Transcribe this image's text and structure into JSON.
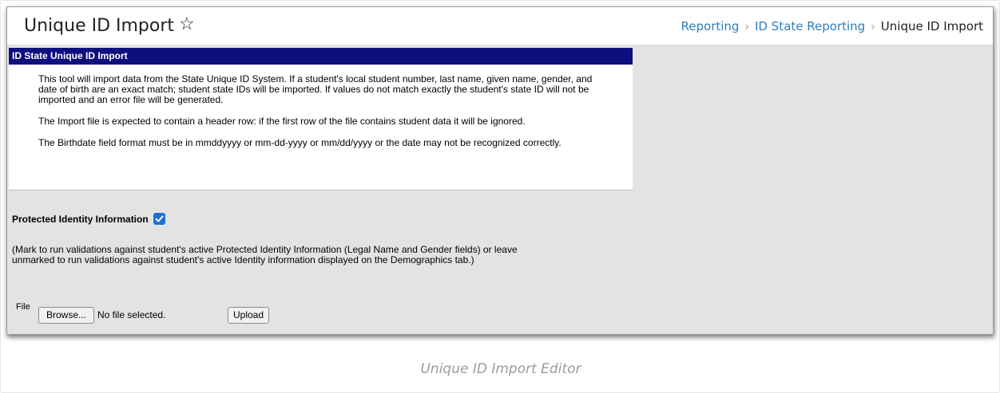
{
  "header": {
    "title": "Unique ID Import",
    "star_glyph": "☆",
    "breadcrumb": [
      {
        "label": "Reporting"
      },
      {
        "label": "ID State Reporting"
      },
      {
        "label": "Unique ID Import"
      }
    ],
    "breadcrumb_separator": "›"
  },
  "panel": {
    "title": "ID State Unique ID Import",
    "paragraphs": [
      "This tool will import data from the State Unique ID System. If a student's local student number, last name, given name, gender, and date of birth are an exact match; student state IDs will be imported. If values do not match exactly the student's state ID will not be imported and an error file will be generated.",
      "The Import file is expected to contain a header row: if the first row of the file contains student data it will be ignored.",
      "The Birthdate field format must be in mmddyyyy or mm-dd-yyyy or mm/dd/yyyy or the date may not be recognized correctly."
    ]
  },
  "form": {
    "pii_label": "Protected Identity Information",
    "pii_checked": true,
    "pii_note": "(Mark to run validations against student's active Protected Identity Information (Legal Name and Gender fields) or leave unmarked to run validations against student's active Identity information displayed on the Demographics tab.)",
    "file_label": "File",
    "browse_label": "Browse...",
    "no_file_text": "No file selected.",
    "upload_label": "Upload"
  },
  "caption": "Unique ID Import Editor",
  "colors": {
    "panel_header": "#0e0f7e",
    "link": "#2e7fbe",
    "checkbox": "#1d6fd6",
    "background": "#e3e3e3"
  }
}
